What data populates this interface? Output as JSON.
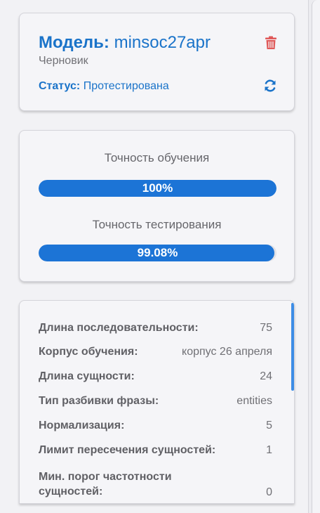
{
  "model": {
    "title_prefix": "Модель:",
    "name": "minsoc27apr",
    "subtitle": "Черновик",
    "status_prefix": "Статус:",
    "status_value": "Протестирована"
  },
  "accuracy": {
    "train_label": "Точность обучения",
    "train_value": "100%",
    "train_fraction": 1.0,
    "test_label": "Точность тестирования",
    "test_value": "99.08%",
    "test_fraction": 0.9908
  },
  "params": [
    {
      "label": "Длина последовательности:",
      "value": "75"
    },
    {
      "label": "Корпус обучения:",
      "value": "корпус 26 апреля"
    },
    {
      "label": "Длина сущности:",
      "value": "24"
    },
    {
      "label": "Тип разбивки фразы:",
      "value": "entities"
    },
    {
      "label": "Нормализация:",
      "value": "5"
    },
    {
      "label": "Лимит пересечения сущностей:",
      "value": "1"
    },
    {
      "label": "Мин. порог частотности сущностей:",
      "value": "0"
    }
  ],
  "colors": {
    "accent": "#1a73c9",
    "bar_fill": "#1c74d6",
    "delete": "#e05a5a"
  },
  "icons": {
    "delete": "trash-icon",
    "refresh": "refresh-icon"
  }
}
